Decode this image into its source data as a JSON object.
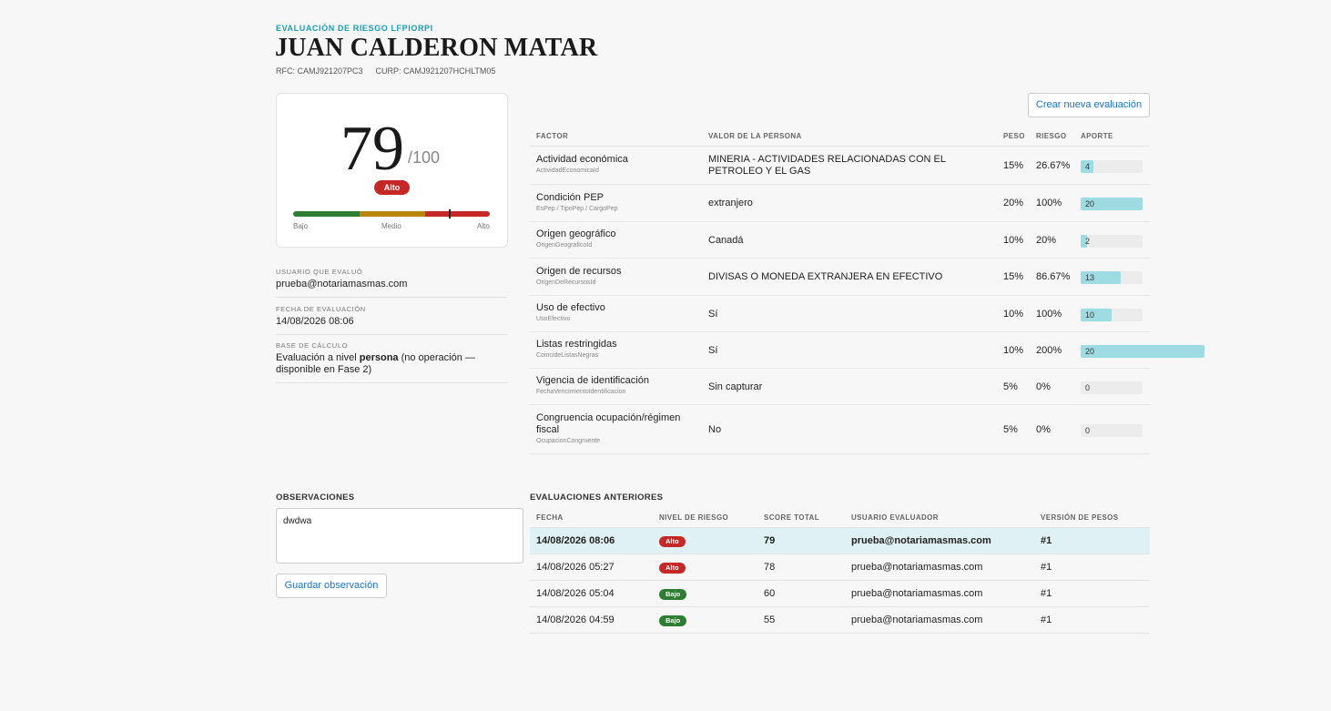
{
  "header": {
    "eyebrow": "EVALUACIÓN DE RIESGO LFPIORPI",
    "name": "JUAN CALDERON MATAR",
    "rfc": "RFC: CAMJ921207PC3",
    "curp": "CURP: CAMJ921207HCHLTM05"
  },
  "score": {
    "value": "79",
    "max": "/100",
    "level": "Alto",
    "gauge_fraction": 0.79,
    "gauge_labels": {
      "low": "Bajo",
      "mid": "Medio",
      "high": "Alto"
    }
  },
  "meta": {
    "user_label": "USUARIO QUE EVALUÓ",
    "user_value": "prueba@notariamasmas.com",
    "date_label": "FECHA DE EVALUACIÓN",
    "date_value": "14/08/2026 08:06",
    "base_label": "BASE DE CÁLCULO",
    "base_pre": "Evaluación a nivel ",
    "base_bold": "persona",
    "base_post": " (no operación — disponible en Fase 2)"
  },
  "actions": {
    "new_eval": "Crear nueva evaluación"
  },
  "factors": {
    "headers": {
      "factor": "FACTOR",
      "value": "VALOR DE LA PERSONA",
      "weight": "PESO",
      "risk": "RIESGO",
      "contribution": "APORTE"
    },
    "rows": [
      {
        "name": "Actividad económica",
        "code": "ActividadEconomicaId",
        "value": "MINERIA - ACTIVIDADES RELACIONADAS CON EL PETROLEO Y EL GAS",
        "weight": "15%",
        "risk": "26.67%",
        "contribution": "4",
        "bar_fraction": 0.2
      },
      {
        "name": "Condición PEP",
        "code": "EsPep / TipoPep / CargoPep",
        "value": "extranjero",
        "weight": "20%",
        "risk": "100%",
        "contribution": "20",
        "bar_fraction": 1.0
      },
      {
        "name": "Origen geográfico",
        "code": "OrigenGeograficoId",
        "value": "Canadá",
        "weight": "10%",
        "risk": "20%",
        "contribution": "2",
        "bar_fraction": 0.1
      },
      {
        "name": "Origen de recursos",
        "code": "OrigenDeRecursosId",
        "value": "DIVISAS O MONEDA EXTRANJERA EN EFECTIVO",
        "weight": "15%",
        "risk": "86.67%",
        "contribution": "13",
        "bar_fraction": 0.65
      },
      {
        "name": "Uso de efectivo",
        "code": "UsoEfectivo",
        "value": "Sí",
        "weight": "10%",
        "risk": "100%",
        "contribution": "10",
        "bar_fraction": 0.5
      },
      {
        "name": "Listas restringidas",
        "code": "CoincideListasNegras",
        "value": "Sí",
        "weight": "10%",
        "risk": "200%",
        "contribution": "20",
        "bar_fraction": 1.0
      },
      {
        "name": "Vigencia de identificación",
        "code": "FechaVencimientoIdentificacion",
        "value": "Sin capturar",
        "weight": "5%",
        "risk": "0%",
        "contribution": "0",
        "bar_fraction": 0
      },
      {
        "name": "Congruencia ocupación/régimen fiscal",
        "code": "OcupacionCongruente",
        "value": "No",
        "weight": "5%",
        "risk": "0%",
        "contribution": "0",
        "bar_fraction": 0
      }
    ]
  },
  "observations": {
    "title": "OBSERVACIONES",
    "text": "dwdwa",
    "save_label": "Guardar observación"
  },
  "previous": {
    "title": "EVALUACIONES ANTERIORES",
    "headers": {
      "date": "FECHA",
      "level": "NIVEL DE RIESGO",
      "score": "SCORE TOTAL",
      "user": "USUARIO EVALUADOR",
      "version": "VERSIÓN DE PESOS"
    },
    "rows": [
      {
        "date": "14/08/2026 08:06",
        "level": "Alto",
        "score": "79",
        "user": "prueba@notariamasmas.com",
        "version": "#1",
        "selected": true
      },
      {
        "date": "14/08/2026 05:27",
        "level": "Alto",
        "score": "78",
        "user": "prueba@notariamasmas.com",
        "version": "#1",
        "selected": false
      },
      {
        "date": "14/08/2026 05:04",
        "level": "Bajo",
        "score": "60",
        "user": "prueba@notariamasmas.com",
        "version": "#1",
        "selected": false
      },
      {
        "date": "14/08/2026 04:59",
        "level": "Bajo",
        "score": "55",
        "user": "prueba@notariamasmas.com",
        "version": "#1",
        "selected": false
      }
    ]
  },
  "colors": {
    "accent": "#1a9fb5",
    "alto": "#c62828",
    "bajo": "#2e7d32",
    "medio": "#b8860b",
    "bar": "#9fdbe3",
    "link": "#1a73c8"
  }
}
